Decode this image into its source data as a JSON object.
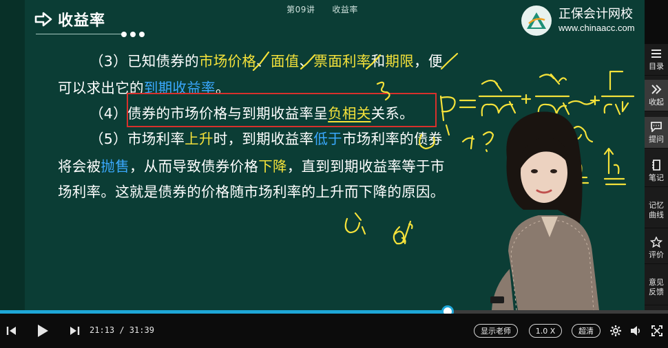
{
  "player": {
    "lecture_title": "第09讲　　收益率",
    "section_title": "收益率",
    "brand_name": "正保会计网校",
    "brand_url": "www.chinaacc.com"
  },
  "slide": {
    "p3_lead": "（3）已知债券的",
    "p3_t1": "市场价格",
    "p3_s1": "、",
    "p3_t2": "面值",
    "p3_s2": "、",
    "p3_t3": "票面利率",
    "p3_s3": "和",
    "p3_t4": "期限",
    "p3_tail": "，便",
    "p3b_lead": "可以求出它的",
    "p3b_t1": "到期收益率",
    "p3b_tail": "。",
    "p4_lead": "（4）债券的市场价格与到期收益率呈",
    "p4_t1": "负相关",
    "p4_tail": "关系。",
    "p5_lead": "（5）市场利率",
    "p5_t1": "上升",
    "p5_m1": "时，到期收益率",
    "p5_t2": "低于",
    "p5_tail": "市场利率的债券",
    "p5b_lead": "将会被",
    "p5b_t1": "抛售",
    "p5b_m1": "，从而导致债券价格",
    "p5b_t2": "下降",
    "p5b_tail": "，直到到期收益率等于市",
    "p5c": "场利率。这就是债券的价格随市场利率的上升而下降的原因。"
  },
  "sidebar": {
    "items": [
      {
        "label": "目录",
        "icon": "list-icon"
      },
      {
        "label": "收起",
        "icon": "double-chevron-right-icon"
      },
      {
        "label": "提问",
        "icon": "chat-bubble-icon"
      },
      {
        "label": "笔记",
        "icon": "notebook-icon"
      },
      {
        "label": "记忆",
        "label2": "曲线"
      },
      {
        "label": "评价",
        "icon": "star-icon"
      },
      {
        "label": "意见",
        "label2": "反馈"
      }
    ]
  },
  "controls": {
    "current_time": "21:13",
    "duration": "31:39",
    "time_display": "21:13 / 31:39",
    "progress_fraction": 0.67,
    "show_teacher_label": "显示老师",
    "speed_label": "1.0 X",
    "quality_label": "超清"
  },
  "colors": {
    "board": "#0b3d35",
    "highlight": "#f5e23a",
    "accent_blue": "#3aa9ff",
    "box": "#d8312c",
    "progress": "#1ea7d8"
  }
}
